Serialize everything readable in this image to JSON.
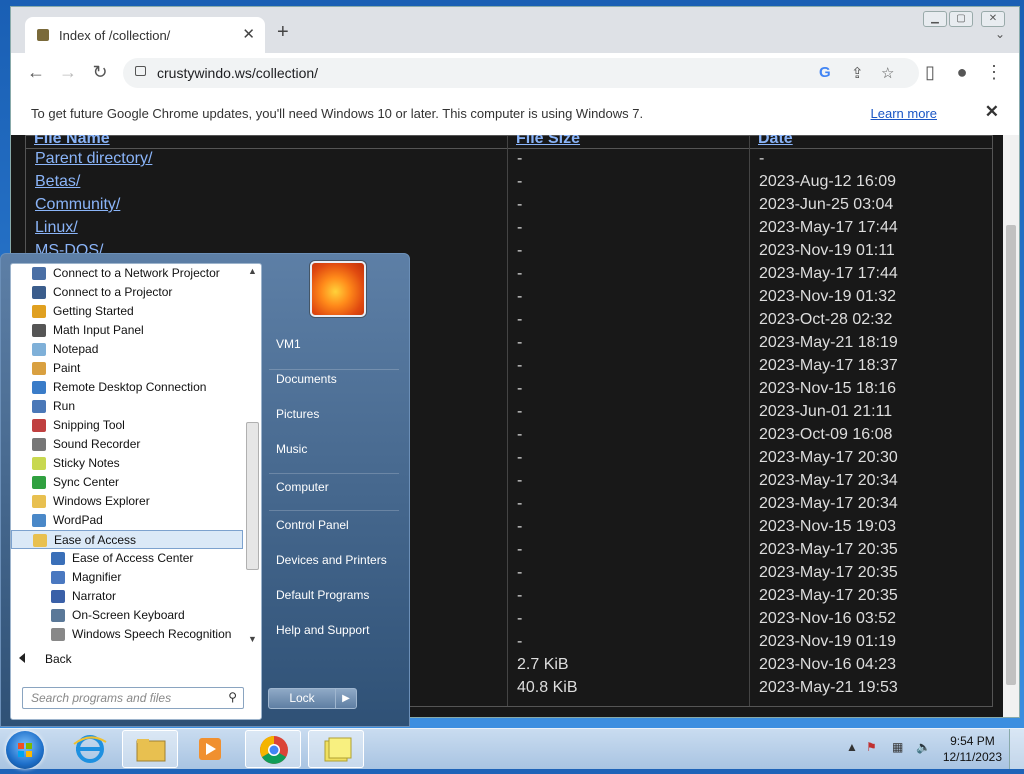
{
  "browser": {
    "tab_title": "Index of /collection/",
    "tab_close": "✕",
    "new_tab": "+",
    "url": "crustywindo.ws/collection/",
    "infobar_message": "To get future Google Chrome updates, you'll need Windows 10 or later. This computer is using Windows 7.",
    "infobar_link": "Learn more",
    "infobar_close": "✕"
  },
  "listing": {
    "headers": {
      "name": "File Name",
      "size": "File Size",
      "date": "Date"
    },
    "rows": [
      {
        "name": "Parent directory/",
        "size": "-",
        "date": "-"
      },
      {
        "name": "Betas/",
        "size": "-",
        "date": "2023-Aug-12 16:09"
      },
      {
        "name": "Community/",
        "size": "-",
        "date": "2023-Jun-25 03:04"
      },
      {
        "name": "Linux/",
        "size": "-",
        "date": "2023-May-17 17:44"
      },
      {
        "name": "MS-DOS/",
        "size": "-",
        "date": "2023-Nov-19 01:11"
      },
      {
        "name": "",
        "size": "-",
        "date": "2023-May-17 17:44"
      },
      {
        "name": "",
        "size": "-",
        "date": "2023-Nov-19 01:32"
      },
      {
        "name": "",
        "size": "-",
        "date": "2023-Oct-28 02:32"
      },
      {
        "name": "",
        "size": "-",
        "date": "2023-May-21 18:19"
      },
      {
        "name": "",
        "size": "-",
        "date": "2023-May-17 18:37"
      },
      {
        "name": "",
        "size": "-",
        "date": "2023-Nov-15 18:16"
      },
      {
        "name": "",
        "size": "-",
        "date": "2023-Jun-01 21:11"
      },
      {
        "name": "",
        "size": "-",
        "date": "2023-Oct-09 16:08"
      },
      {
        "name": "",
        "size": "-",
        "date": "2023-May-17 20:30"
      },
      {
        "name": "",
        "size": "-",
        "date": "2023-May-17 20:34"
      },
      {
        "name": "",
        "size": "-",
        "date": "2023-May-17 20:34"
      },
      {
        "name": "",
        "size": "-",
        "date": "2023-Nov-15 19:03"
      },
      {
        "name": "",
        "size": "-",
        "date": "2023-May-17 20:35"
      },
      {
        "name": "",
        "size": "-",
        "date": "2023-May-17 20:35"
      },
      {
        "name": "",
        "size": "-",
        "date": "2023-May-17 20:35"
      },
      {
        "name": "",
        "size": "-",
        "date": "2023-Nov-16 03:52"
      },
      {
        "name": "",
        "size": "-",
        "date": "2023-Nov-19 01:19"
      },
      {
        "name": "",
        "size": "2.7 KiB",
        "date": "2023-Nov-16 04:23"
      },
      {
        "name": "",
        "size": "40.8 KiB",
        "date": "2023-May-21 19:53"
      }
    ]
  },
  "start_menu": {
    "programs": [
      {
        "label": "Connect to a Network Projector",
        "icon": "network-projector-icon",
        "color": "#4a6fa5",
        "indent": false
      },
      {
        "label": "Connect to a Projector",
        "icon": "projector-icon",
        "color": "#3b5d8c",
        "indent": false
      },
      {
        "label": "Getting Started",
        "icon": "getting-started-icon",
        "color": "#e0a020",
        "indent": false
      },
      {
        "label": "Math Input Panel",
        "icon": "math-input-icon",
        "color": "#555555",
        "indent": false
      },
      {
        "label": "Notepad",
        "icon": "notepad-icon",
        "color": "#7fb0d8",
        "indent": false
      },
      {
        "label": "Paint",
        "icon": "paint-icon",
        "color": "#d9a040",
        "indent": false
      },
      {
        "label": "Remote Desktop Connection",
        "icon": "remote-desktop-icon",
        "color": "#3a7cc8",
        "indent": false
      },
      {
        "label": "Run",
        "icon": "run-icon",
        "color": "#4a78b8",
        "indent": false
      },
      {
        "label": "Snipping Tool",
        "icon": "scissors-icon",
        "color": "#c04040",
        "indent": false
      },
      {
        "label": "Sound Recorder",
        "icon": "microphone-icon",
        "color": "#777777",
        "indent": false
      },
      {
        "label": "Sticky Notes",
        "icon": "sticky-notes-icon",
        "color": "#c8d850",
        "indent": false
      },
      {
        "label": "Sync Center",
        "icon": "sync-icon",
        "color": "#30a040",
        "indent": false
      },
      {
        "label": "Windows Explorer",
        "icon": "folder-icon",
        "color": "#e8c050",
        "indent": false
      },
      {
        "label": "WordPad",
        "icon": "wordpad-icon",
        "color": "#4a88c8",
        "indent": false
      },
      {
        "label": "Ease of Access",
        "icon": "folder-icon",
        "color": "#e8c050",
        "indent": false,
        "selected": true
      },
      {
        "label": "Ease of Access Center",
        "icon": "ease-of-access-icon",
        "color": "#3a6fb8",
        "indent": true
      },
      {
        "label": "Magnifier",
        "icon": "magnifier-icon",
        "color": "#4a78c0",
        "indent": true
      },
      {
        "label": "Narrator",
        "icon": "narrator-icon",
        "color": "#3a60a8",
        "indent": true
      },
      {
        "label": "On-Screen Keyboard",
        "icon": "keyboard-icon",
        "color": "#5a7898",
        "indent": true
      },
      {
        "label": "Windows Speech Recognition",
        "icon": "microphone-icon",
        "color": "#888888",
        "indent": true
      }
    ],
    "back_label": "Back",
    "search_placeholder": "Search programs and files",
    "right_links": [
      "VM1",
      "Documents",
      "Pictures",
      "Music",
      "Computer",
      "Control Panel",
      "Devices and Printers",
      "Default Programs",
      "Help and Support"
    ],
    "lock_label": "Lock",
    "lock_arrow": "▶"
  },
  "taskbar": {
    "time": "9:54 PM",
    "date": "12/11/2023",
    "pinned": [
      "ie-icon",
      "explorer-folder-icon",
      "media-player-icon",
      "chrome-icon",
      "sticky-notes-icon"
    ]
  }
}
